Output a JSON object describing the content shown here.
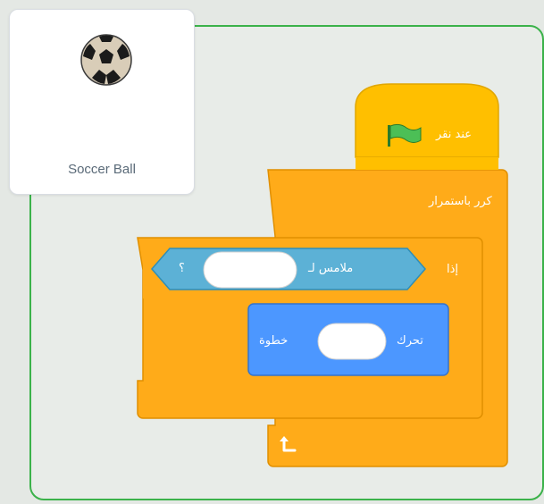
{
  "sprite": {
    "name": "Soccer Ball",
    "thumbnail_icon": "soccer-ball-icon"
  },
  "script": {
    "hat_block": {
      "label": "عند نقر",
      "icon": "green-flag-icon",
      "color": "#ffbf00"
    },
    "forever_block": {
      "label": "كرر باستمرار",
      "color": "#ffab19"
    },
    "if_block": {
      "label": "إذا",
      "color": "#ffab19"
    },
    "sensing_block": {
      "label": "ملامس لـ",
      "suffix": "؟",
      "input_value": "",
      "color": "#5cb1d6"
    },
    "motion_block": {
      "label": "تحرك",
      "input_value": "",
      "suffix": "خطوة",
      "color": "#4c97ff"
    },
    "loop_arrow_icon": "loop-arrow-icon"
  },
  "colors": {
    "stage_border": "#3bb24a",
    "control": "#ffab19",
    "events": "#ffbf00",
    "sensing": "#5cb1d6",
    "motion": "#4c97ff"
  }
}
